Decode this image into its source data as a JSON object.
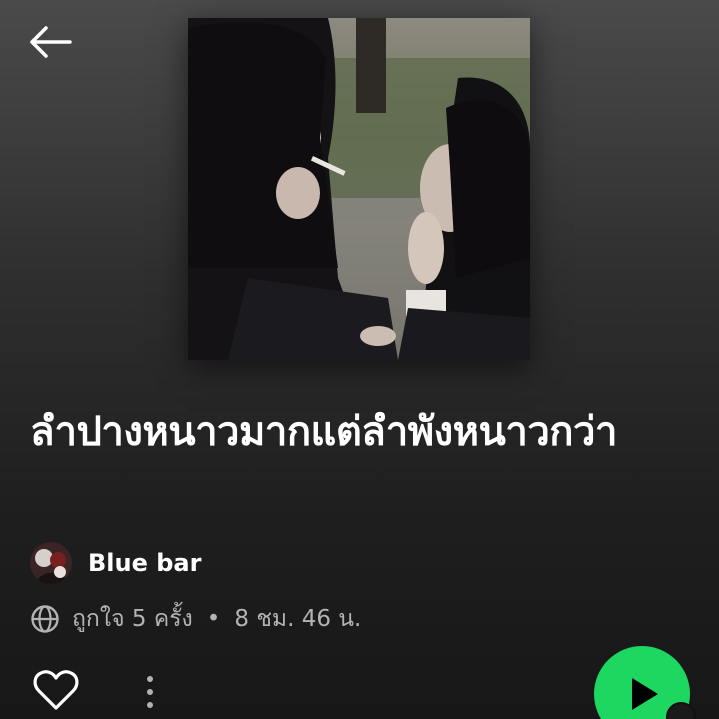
{
  "header": {
    "back_icon": "arrow-left-icon"
  },
  "playlist": {
    "title": "ลำปางหนาวมากแต่ลำพังหนาวกว่า",
    "owner_name": "Blue bar",
    "globe_icon": "globe-icon",
    "likes_text": "ถูกใจ 5 ครั้ง",
    "separator": "•",
    "duration_text": "8 ชม. 46 น."
  },
  "actions": {
    "like_icon": "heart-outline-icon",
    "more_icon": "more-vertical-icon",
    "play_icon": "play-icon"
  },
  "colors": {
    "accent": "#1ed760",
    "secondary_text": "#b3b3b3",
    "background": "#121212"
  }
}
